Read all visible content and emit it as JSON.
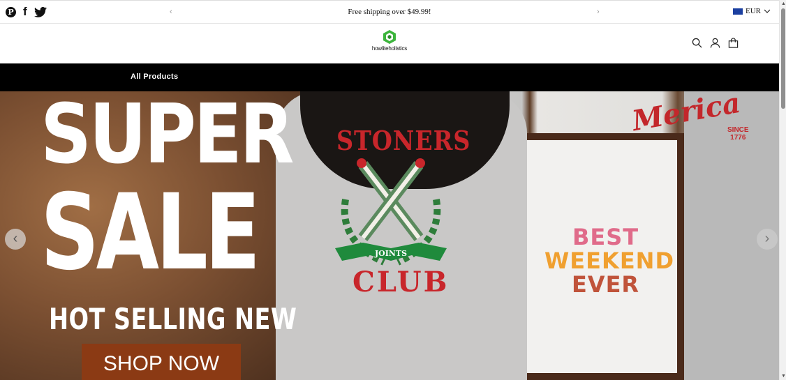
{
  "topbar": {
    "social_icons": [
      "pinterest-icon",
      "facebook-icon",
      "twitter-icon"
    ],
    "prev_arrow": "‹",
    "next_arrow": "›",
    "announcement": "Free shipping over $49.99!",
    "currency": "EUR"
  },
  "header": {
    "logo_text": "howliteholistics",
    "icons": [
      "search-icon",
      "account-icon",
      "cart-icon"
    ]
  },
  "nav": {
    "items": [
      {
        "label": "All Products"
      }
    ]
  },
  "hero": {
    "line1": "SUPER",
    "line2": "SALE",
    "line3": "HOT SELLING NEW",
    "cta": "SHOP NOW",
    "shirt1_top": "STONERS",
    "shirt1_ribbon": "JOINTS",
    "shirt1_bottom": "CLUB",
    "shirt2": [
      "BEST",
      "WEEKEND",
      "EVER"
    ],
    "shirt3_script": "Merica",
    "shirt3_small": [
      "SINCE",
      "1776"
    ],
    "prev": "‹",
    "next": "›"
  },
  "colors": {
    "nav_bg": "#000000",
    "cta_bg": "#8b3a14",
    "logo_green": "#3cb53c",
    "shirt_red": "#c8262b"
  }
}
